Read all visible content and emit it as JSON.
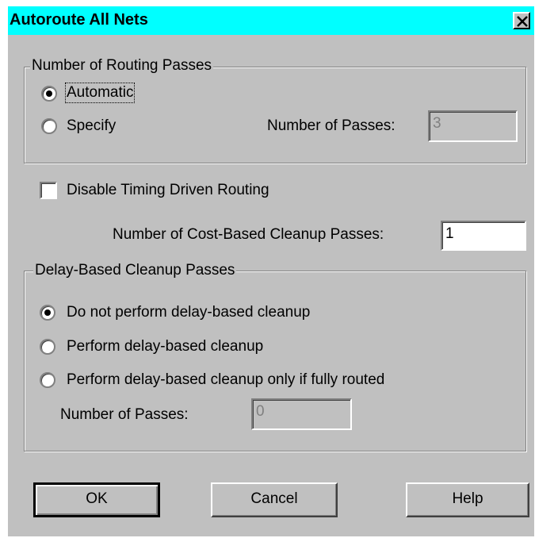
{
  "window": {
    "title": "Autoroute All Nets",
    "close_glyph": "✕"
  },
  "routing_passes": {
    "legend": "Number of Routing Passes",
    "automatic_label": "Automatic",
    "specify_label": "Specify",
    "selected": "automatic",
    "num_passes_label": "Number of Passes:",
    "num_passes_value": "3"
  },
  "timing": {
    "disable_label": "Disable Timing Driven Routing",
    "checked": false
  },
  "cost_cleanup": {
    "label": "Number of Cost-Based Cleanup Passes:",
    "value": "1"
  },
  "delay_cleanup": {
    "legend": "Delay-Based Cleanup Passes",
    "options": [
      "Do not perform delay-based cleanup",
      "Perform delay-based cleanup",
      "Perform delay-based cleanup only if fully routed"
    ],
    "selected_index": 0,
    "num_passes_label": "Number of Passes:",
    "num_passes_value": "0"
  },
  "buttons": {
    "ok": "OK",
    "cancel": "Cancel",
    "help": "Help"
  },
  "colors": {
    "title_bar": "#00ffff",
    "face": "#c0c0c0"
  }
}
